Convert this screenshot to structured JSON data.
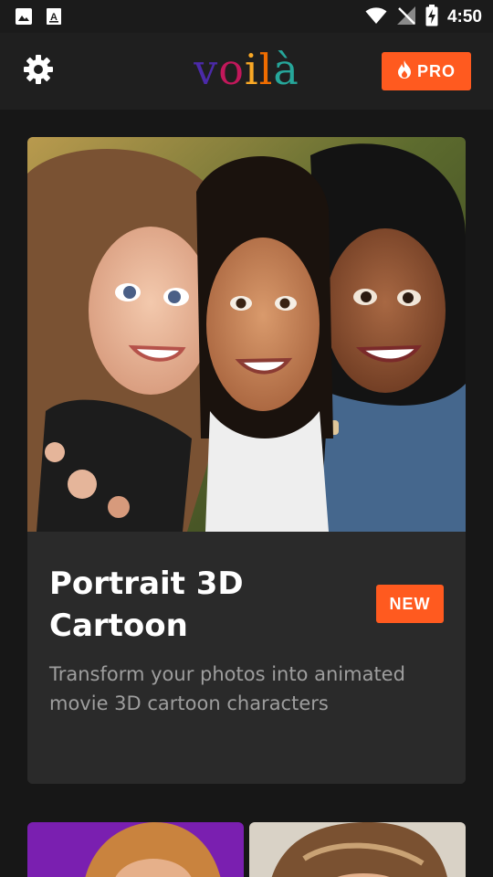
{
  "status_bar": {
    "time": "4:50",
    "left_icons": [
      "gallery-icon",
      "accessibility-text-icon"
    ],
    "right_icons": [
      "wifi-icon",
      "no-signal-icon",
      "battery-charging-icon"
    ]
  },
  "app_bar": {
    "logo_letters": [
      "v",
      "o",
      "i",
      "l",
      "à"
    ],
    "logo_colors": [
      "#4b2aa8",
      "#c2185b",
      "#f9a825",
      "#ef6c00",
      "#26a69a"
    ],
    "pro_label": "PRO",
    "settings_icon": "gear-icon",
    "pro_icon": "flame-icon"
  },
  "feature_card": {
    "title": "Portrait 3D Cartoon",
    "badge": "NEW",
    "description": "Transform your photos into animated movie 3D cartoon characters"
  },
  "colors": {
    "accent": "#ff5a1f",
    "background": "#171717",
    "card": "#2a2a2a",
    "muted_text": "#9e9e9e"
  }
}
